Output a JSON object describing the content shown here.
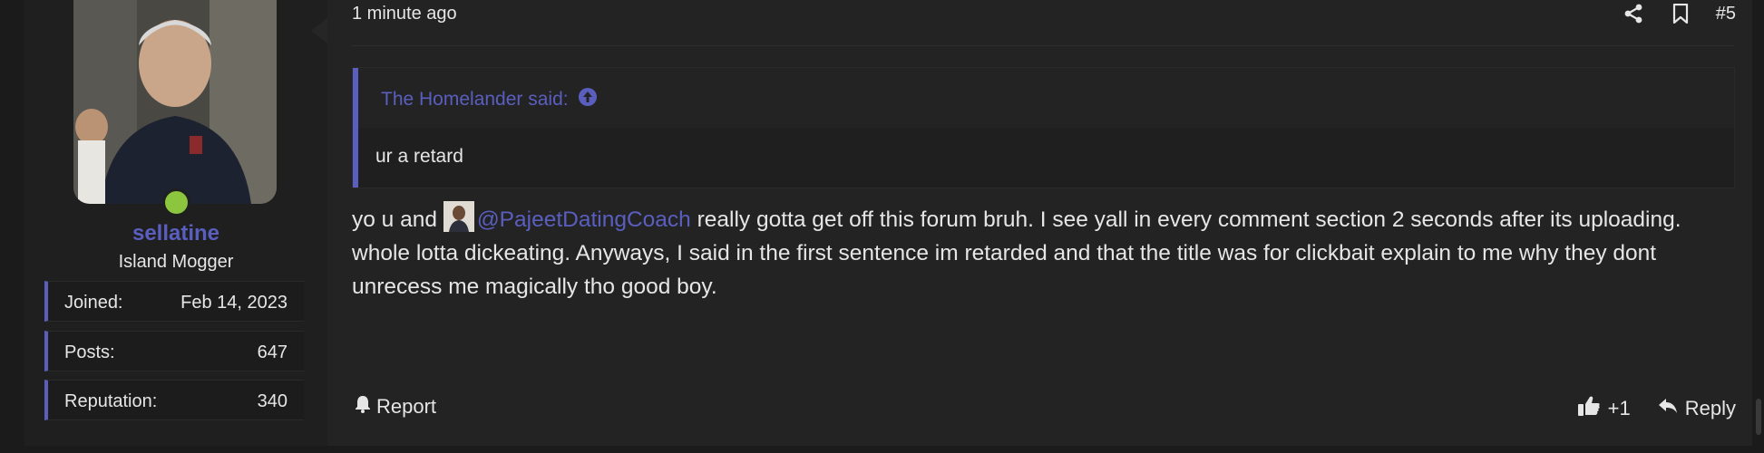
{
  "user": {
    "name": "sellatine",
    "title": "Island Mogger",
    "stats": [
      {
        "label": "Joined:",
        "value": "Feb 14, 2023"
      },
      {
        "label": "Posts:",
        "value": "647"
      },
      {
        "label": "Reputation:",
        "value": "340"
      }
    ]
  },
  "post": {
    "time": "1 minute ago",
    "number": "#5",
    "quote": {
      "author": "The Homelander said:",
      "text": "ur a retard"
    },
    "message": {
      "before": "yo u and ",
      "mention": "@PajeetDatingCoach",
      "after": " really gotta get off this forum bruh. I see yall in every comment section 2 seconds after its uploading. whole lotta dickeating. Anyways, I said in the first sentence im retarded and that the title was for clickbait explain to me why they dont unrecess me magically tho good boy."
    },
    "actions": {
      "report": "Report",
      "like": "+1",
      "reply": "Reply"
    }
  },
  "colors": {
    "accent": "#5a5fbf",
    "online": "#8cc63f",
    "background": "#232323"
  }
}
